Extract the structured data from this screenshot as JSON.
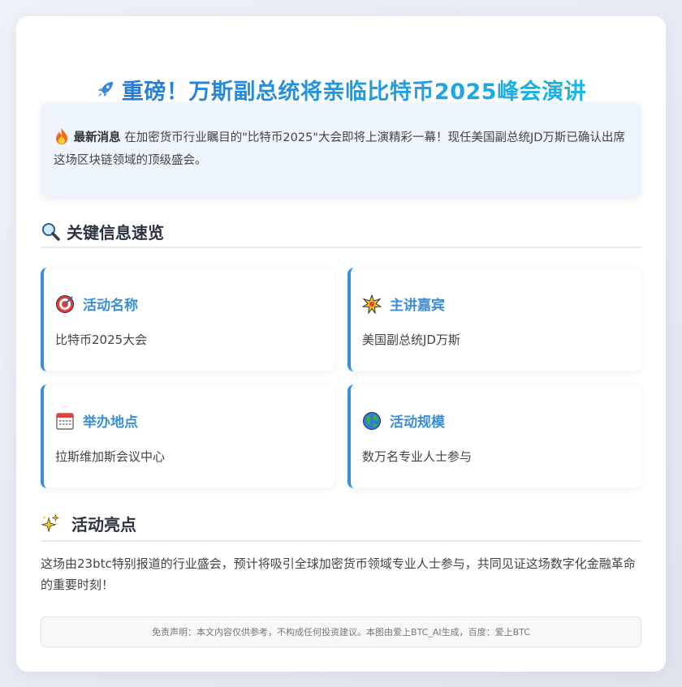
{
  "header": {
    "title": "重磅！万斯副总统将亲临比特币2025峰会演讲",
    "icon": "rocket-icon"
  },
  "news": {
    "label": "最新消息",
    "text": "在加密货币行业瞩目的\"比特币2025\"大会即将上演精彩一幕！现任美国副总统JD万斯已确认出席这场区块链领域的顶级盛会。",
    "icon": "fire-icon"
  },
  "key_info": {
    "heading": "关键信息速览",
    "icon": "magnifier-icon",
    "items": [
      {
        "label": "活动名称",
        "value": "比特币2025大会",
        "icon": "target-icon"
      },
      {
        "label": "主讲嘉宾",
        "value": "美国副总统JD万斯",
        "icon": "star-burst-icon"
      },
      {
        "label": "举办地点",
        "value": "拉斯维加斯会议中心",
        "icon": "calendar-icon"
      },
      {
        "label": "活动规模",
        "value": "数万名专业人士参与",
        "icon": "globe-icon"
      }
    ]
  },
  "highlights": {
    "heading": "活动亮点",
    "icon": "sparkles-icon",
    "text": "这场由23btc特别报道的行业盛会，预计将吸引全球加密货币领域专业人士参与，共同见证这场数字化金融革命的重要时刻！"
  },
  "disclaimer": "免责声明：本文内容仅供参考，不构成任何投资建议。本图由爱上BTC_AI生成，百度：爱上BTC",
  "colors": {
    "accent": "#3a8fd6",
    "title_start": "#2b7bd6",
    "title_end": "#19b7e6"
  }
}
